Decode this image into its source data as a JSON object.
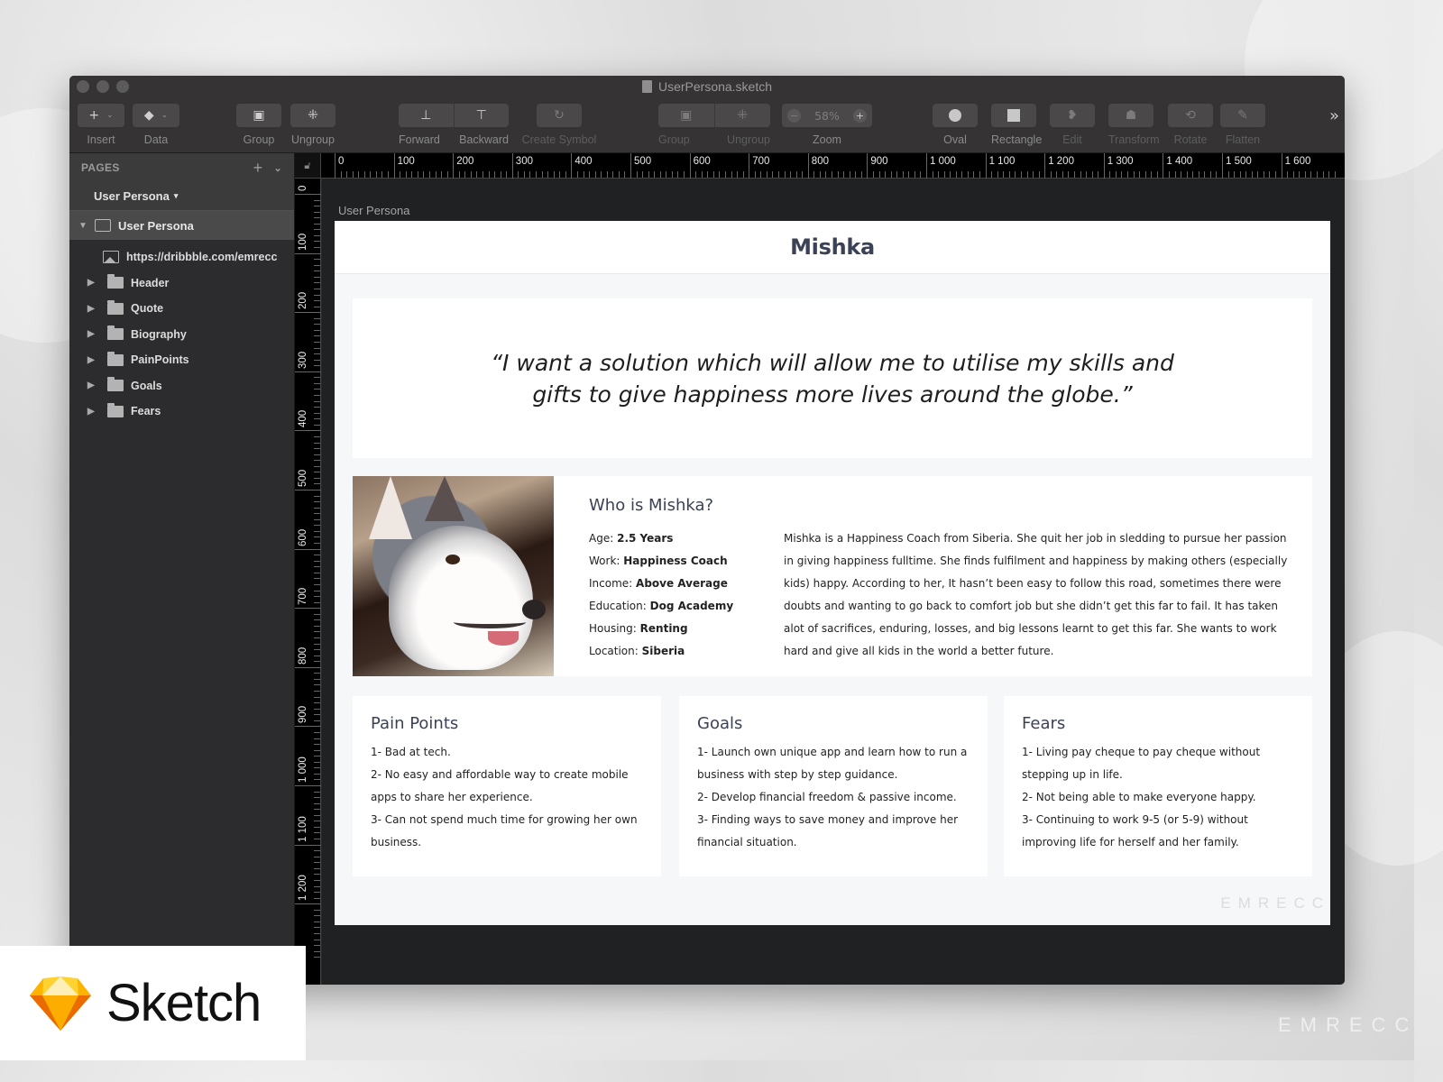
{
  "window": {
    "document_title": "UserPersona.sketch"
  },
  "toolbar": {
    "insert": "Insert",
    "data": "Data",
    "group": "Group",
    "ungroup": "Ungroup",
    "forward": "Forward",
    "backward": "Backward",
    "create_symbol": "Create Symbol",
    "group2": "Group",
    "ungroup2": "Ungroup",
    "zoom_label": "Zoom",
    "zoom_value": "58%",
    "zoom_minus": "−",
    "zoom_plus": "+",
    "oval": "Oval",
    "rectangle": "Rectangle",
    "edit": "Edit",
    "transform": "Transform",
    "rotate": "Rotate",
    "flatten": "Flatten",
    "more": "»"
  },
  "sidebar": {
    "pages_label": "PAGES",
    "add_page": "+",
    "collapse": "⌄",
    "current_page": "User Persona",
    "artboard_layer": "User Persona",
    "layers": [
      {
        "name": "https://dribbble.com/emrecc",
        "type": "image"
      },
      {
        "name": "Header",
        "type": "group"
      },
      {
        "name": "Quote",
        "type": "group"
      },
      {
        "name": "Biography",
        "type": "group"
      },
      {
        "name": "PainPoints",
        "type": "group"
      },
      {
        "name": "Goals",
        "type": "group"
      },
      {
        "name": "Fears",
        "type": "group"
      }
    ]
  },
  "rulers": {
    "horizontal": [
      "0",
      "100",
      "200",
      "300",
      "400",
      "500",
      "600",
      "700",
      "800",
      "900",
      "1 000",
      "1 100",
      "1 200",
      "1 300",
      "1 400",
      "1 500",
      "1 600"
    ],
    "vertical": [
      "0",
      "100",
      "200",
      "300",
      "400",
      "500",
      "600",
      "700",
      "800",
      "900",
      "1 000",
      "1 100",
      "1 200"
    ]
  },
  "artboard": {
    "label": "User Persona",
    "name": "Mishka",
    "quote": "“I want a solution which will allow me to utilise my skills and gifts to give happiness more lives around the globe.”",
    "bio": {
      "title": "Who is Mishka?",
      "facts": [
        {
          "label": "Age:",
          "value": "2.5 Years"
        },
        {
          "label": "Work:",
          "value": "Happiness Coach"
        },
        {
          "label": "Income:",
          "value": "Above Average"
        },
        {
          "label": "Education:",
          "value": "Dog Academy"
        },
        {
          "label": "Housing:",
          "value": "Renting"
        },
        {
          "label": "Location:",
          "value": "Siberia"
        }
      ],
      "text": "Mishka is a Happiness Coach from Siberia. She quit her job in sledding to pursue her passion in giving happiness fulltime. She finds fulfilment and happiness by making others (especially kids) happy. According to her, It hasn’t been easy to follow this road, sometimes there were doubts and wanting to go back to comfort job but she didn’t get this far to fail. It has taken alot of sacrifices, enduring, losses, and big lessons learnt to get this far. She wants to work hard and give all kids in the world a better future."
    },
    "pain_points": {
      "title": "Pain Points",
      "items": [
        "1- Bad at tech.",
        "2- No easy and affordable way to create mobile apps to share her experience.",
        "3- Can not spend much time for growing her own business."
      ]
    },
    "goals": {
      "title": "Goals",
      "items": [
        "1- Launch own unique app and learn how to run a business with step by step guidance.",
        "2- Develop financial freedom & passive income.",
        "3- Finding ways to save money and improve her financial situation."
      ]
    },
    "fears": {
      "title": "Fears",
      "items": [
        "1- Living pay cheque to pay cheque without stepping up in life.",
        "2- Not being able to make everyone happy.",
        "3- Continuing to work 9-5 (or 5-9) without improving life for herself and her family."
      ]
    },
    "watermark": "EMRECC"
  },
  "badge": {
    "brand": "Sketch"
  },
  "colors": {
    "heading": "#3b4256",
    "toolbar_bg": "#353333",
    "sidebar_bg": "#2c2c2e",
    "canvas_bg": "#202123",
    "sketch_gem": "#f7b500"
  }
}
